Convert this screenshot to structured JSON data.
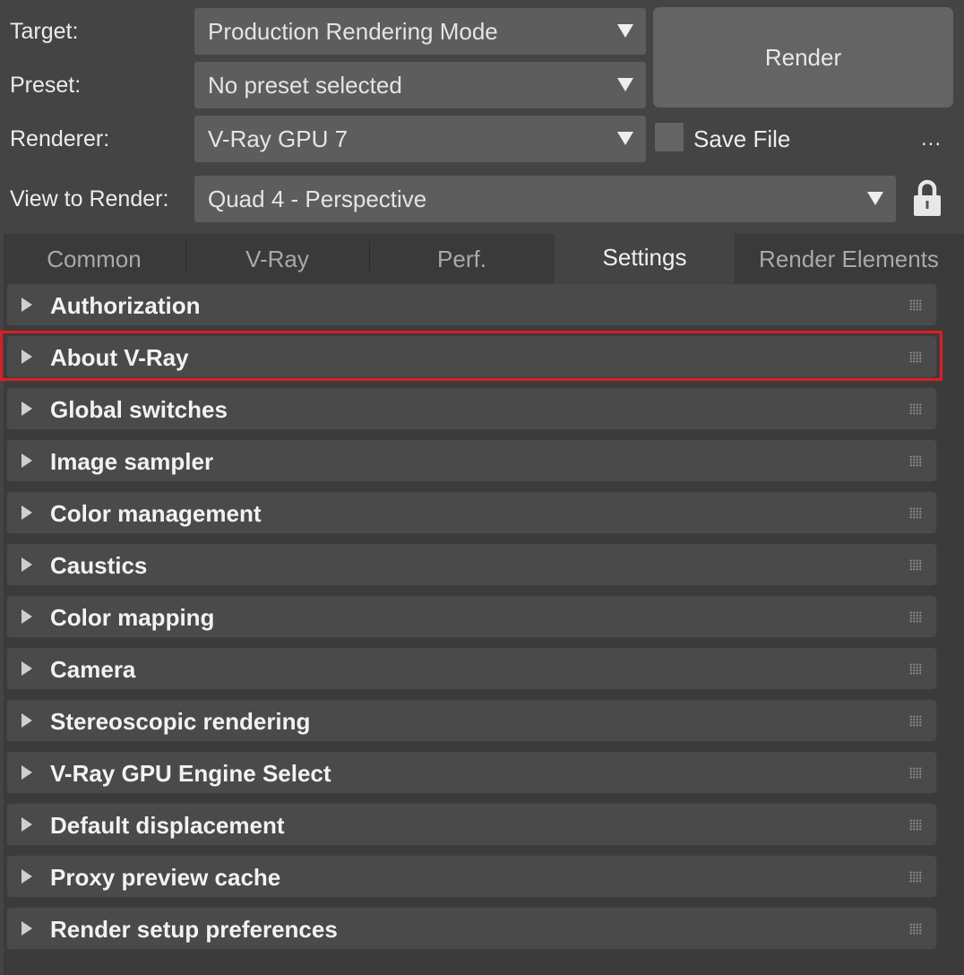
{
  "header": {
    "target_label": "Target:",
    "target_value": "Production Rendering Mode",
    "preset_label": "Preset:",
    "preset_value": "No preset selected",
    "renderer_label": "Renderer:",
    "renderer_value": "V-Ray GPU 7",
    "view_label": "View to Render:",
    "view_value": "Quad 4 - Perspective",
    "render_button": "Render",
    "save_file_label": "Save File",
    "save_file_checked": false,
    "more_label": "...",
    "lock_icon": "lock-icon"
  },
  "tabs": [
    {
      "label": "Common",
      "active": false
    },
    {
      "label": "V-Ray",
      "active": false
    },
    {
      "label": "Perf.",
      "active": false
    },
    {
      "label": "Settings",
      "active": true
    },
    {
      "label": "Render Elements",
      "active": false
    }
  ],
  "rollouts": [
    {
      "label": "Authorization"
    },
    {
      "label": "About V-Ray",
      "highlighted": true
    },
    {
      "label": "Global switches"
    },
    {
      "label": "Image sampler"
    },
    {
      "label": "Color management"
    },
    {
      "label": "Caustics"
    },
    {
      "label": "Color mapping"
    },
    {
      "label": "Camera"
    },
    {
      "label": "Stereoscopic rendering"
    },
    {
      "label": "V-Ray GPU Engine Select"
    },
    {
      "label": "Default displacement"
    },
    {
      "label": "Proxy preview cache"
    },
    {
      "label": "Render setup preferences"
    }
  ],
  "colors": {
    "highlight": "#e01b24",
    "background": "#444444"
  }
}
